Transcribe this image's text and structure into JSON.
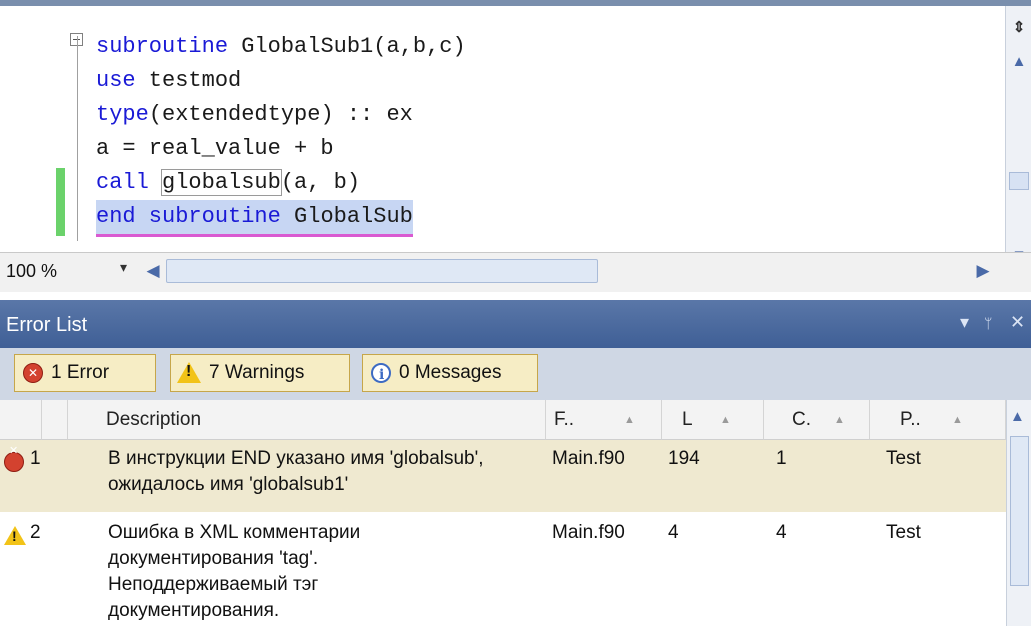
{
  "editor": {
    "code_lines": [
      [
        {
          "t": "subroutine",
          "k": true
        },
        {
          "t": " GlobalSub1(a,b,c)",
          "k": false
        }
      ],
      [
        {
          "t": "use",
          "k": true
        },
        {
          "t": " testmod",
          "k": false
        }
      ],
      [
        {
          "t": "type",
          "k": true
        },
        {
          "t": "(extendedtype) :: ex",
          "k": false
        }
      ],
      [
        {
          "t": "a = real_value + b",
          "k": false
        }
      ],
      [
        {
          "t": "call",
          "k": true
        },
        {
          "t": " ",
          "k": false
        },
        {
          "t": "globalsub",
          "k": false,
          "box": true
        },
        {
          "t": "(a, b)",
          "k": false
        }
      ],
      [
        {
          "t": "end subroutine",
          "k": true
        },
        {
          "t": " GlobalSub",
          "k": false,
          "sel": true
        }
      ]
    ],
    "zoom_label": "100 %",
    "zoom_dropdown": "▾",
    "scroll_up": "▲",
    "scroll_down": "▼",
    "scroll_left": "◀",
    "scroll_right": "▶",
    "split_icon": "⇕"
  },
  "error_list": {
    "title": "Error List",
    "title_controls": {
      "dropdown": "▾",
      "pin": "📌",
      "close": "✕"
    },
    "filters": {
      "errors": "1 Error",
      "warnings": "7 Warnings",
      "messages": "0 Messages"
    },
    "columns": {
      "description": "Description",
      "file": "F..",
      "line": "L",
      "column": "C.",
      "project": "P.."
    },
    "sort_glyph": "▲",
    "rows": [
      {
        "severity": "error",
        "num": "1",
        "description": "В инструкции END указано имя 'globalsub', ожидалось имя 'globalsub1'",
        "file": "Main.f90",
        "line": "194",
        "column": "1",
        "project": "Test"
      },
      {
        "severity": "warning",
        "num": "2",
        "description": "Ошибка в XML комментарии документирования 'tag'. Неподдерживаемый тэг документирования.",
        "file": "Main.f90",
        "line": "4",
        "column": "4",
        "project": "Test"
      }
    ],
    "warning_mark": "!"
  },
  "colors": {
    "keyword": "#1a1ad6",
    "title_bar": "#4a6aa0",
    "error_icon": "#d3422f",
    "warning_icon": "#f2c318",
    "change_bar": "#6bd26b"
  }
}
